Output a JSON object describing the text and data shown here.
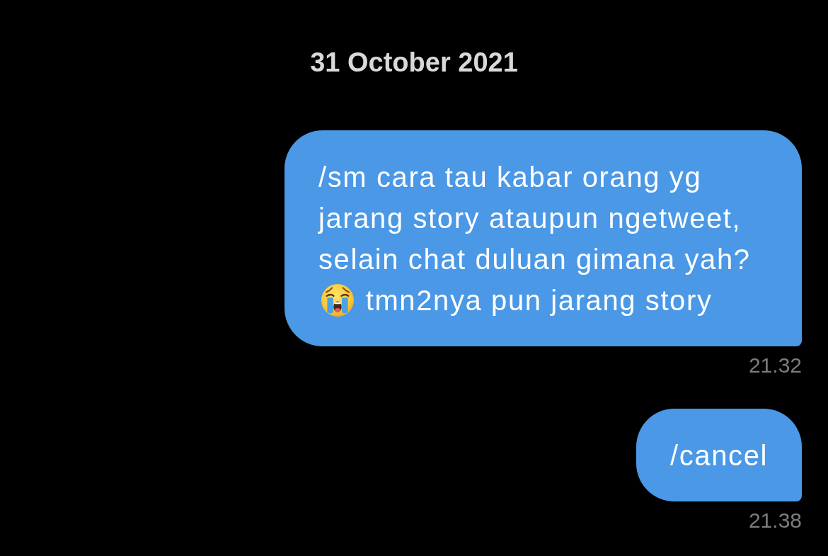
{
  "date_divider": "31 October 2021",
  "messages": [
    {
      "parts": [
        {
          "kind": "text",
          "text": "/sm cara tau kabar orang yg jarang story ataupun ngetweet, selain chat duluan gimana yah?"
        },
        {
          "kind": "emoji"
        },
        {
          "kind": "text",
          "text": "tmn2nya pun jarang story"
        }
      ],
      "time": "21.32"
    },
    {
      "parts": [
        {
          "kind": "text",
          "text": "/cancel"
        }
      ],
      "time": "21.38"
    }
  ]
}
